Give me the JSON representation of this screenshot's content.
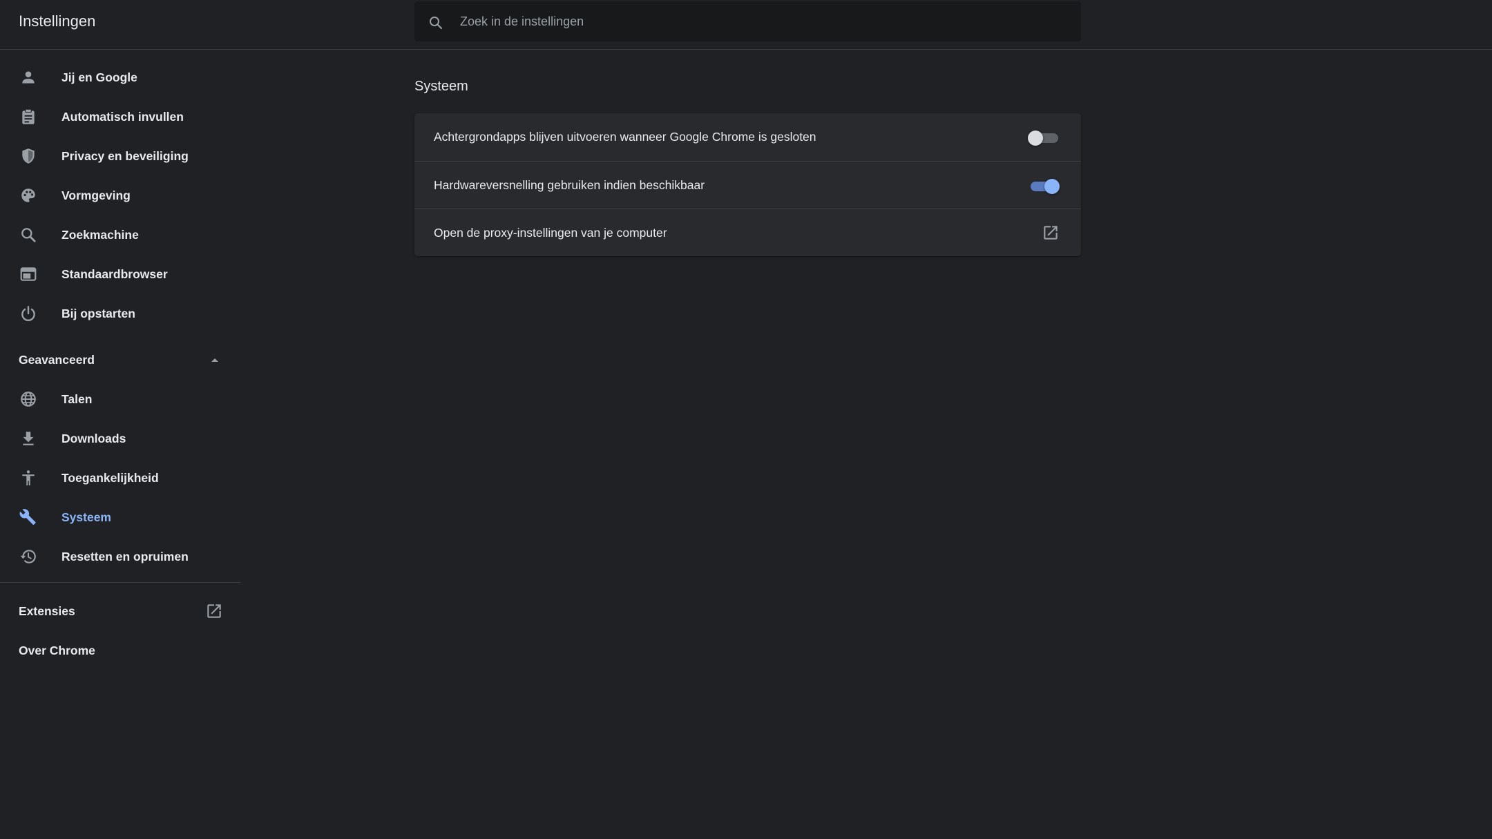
{
  "header": {
    "title": "Instellingen",
    "search_placeholder": "Zoek in de instellingen"
  },
  "sidebar": {
    "items": [
      {
        "label": "Jij en Google",
        "icon": "person-icon"
      },
      {
        "label": "Automatisch invullen",
        "icon": "clipboard-icon"
      },
      {
        "label": "Privacy en beveiliging",
        "icon": "shield-icon"
      },
      {
        "label": "Vormgeving",
        "icon": "palette-icon"
      },
      {
        "label": "Zoekmachine",
        "icon": "search-icon"
      },
      {
        "label": "Standaardbrowser",
        "icon": "browser-window-icon"
      },
      {
        "label": "Bij opstarten",
        "icon": "power-icon"
      }
    ],
    "advanced": {
      "label": "Geavanceerd",
      "expanded": true,
      "items": [
        {
          "label": "Talen",
          "icon": "globe-icon"
        },
        {
          "label": "Downloads",
          "icon": "download-icon"
        },
        {
          "label": "Toegankelijkheid",
          "icon": "accessibility-icon"
        },
        {
          "label": "Systeem",
          "icon": "wrench-icon",
          "active": true
        },
        {
          "label": "Resetten en opruimen",
          "icon": "history-icon"
        }
      ]
    },
    "extensions_label": "Extensies",
    "about_label": "Over Chrome"
  },
  "main": {
    "section_title": "Systeem",
    "rows": [
      {
        "label": "Achtergrondapps blijven uitvoeren wanneer Google Chrome is gesloten",
        "toggle": false
      },
      {
        "label": "Hardwareversnelling gebruiken indien beschikbaar",
        "toggle": true
      },
      {
        "label": "Open de proxy-instellingen van je computer",
        "external": true
      }
    ]
  },
  "colors": {
    "background": "#202124",
    "card": "#292a2d",
    "accent": "#8ab4f8",
    "text": "#e8eaed",
    "icon": "#9aa0a6"
  }
}
